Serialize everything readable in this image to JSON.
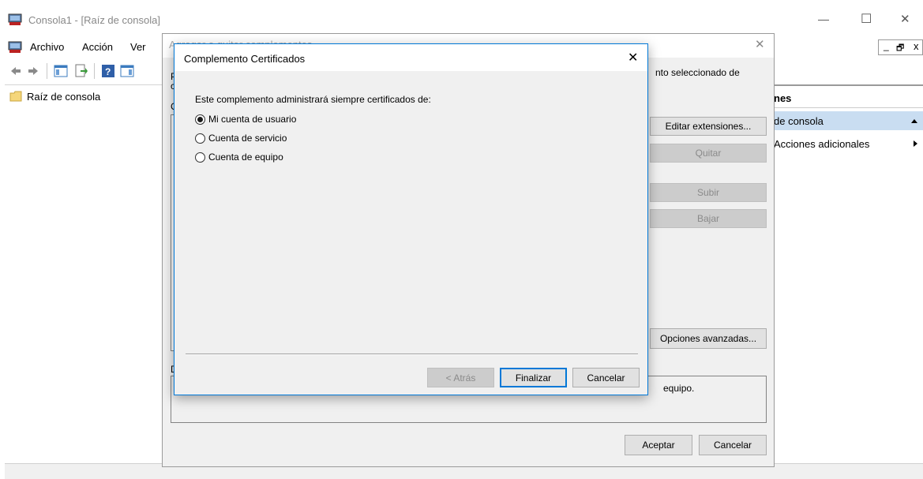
{
  "main_window": {
    "title": "Consola1 - [Raíz de consola]",
    "menu": [
      "Archivo",
      "Acción",
      "Ver"
    ],
    "tree_root": "Raíz de consola",
    "minimize_glyph": "—",
    "maximize_glyph": "☐",
    "close_glyph": "✕",
    "mdi_minimize_glyph": "_",
    "mdi_restore_glyph": "🗗",
    "mdi_close_glyph": "x"
  },
  "actions_pane": {
    "header": "nes",
    "selected_item": "de consola",
    "item_more": "Acciones adicionales"
  },
  "addremove_dialog": {
    "title": "Agregar o quitar complementos",
    "desc_partial": "nto seleccionado de",
    "left_edge_letter_1": "P",
    "left_edge_letter_2": "c",
    "left_edge_letter_3": "C",
    "left_edge_letter_4": "D",
    "buttons": {
      "edit_extensions": "Editar extensiones...",
      "remove": "Quitar",
      "move_up": "Subir",
      "move_down": "Bajar",
      "advanced": "Opciones avanzadas..."
    },
    "description_text": "equipo.",
    "ok": "Aceptar",
    "cancel": "Cancelar"
  },
  "cert_dialog": {
    "title": "Complemento Certificados",
    "prompt": "Este complemento administrará siempre certificados de:",
    "options": [
      {
        "label": "Mi cuenta de usuario",
        "checked": true
      },
      {
        "label": "Cuenta de servicio",
        "checked": false
      },
      {
        "label": "Cuenta de equipo",
        "checked": false
      }
    ],
    "back": "< Atrás",
    "finish": "Finalizar",
    "cancel": "Cancelar",
    "close_glyph": "✕"
  },
  "colors": {
    "accent": "#0078d7",
    "selection": "#c9ddf1",
    "dialog_bg": "#f0f0f0"
  }
}
